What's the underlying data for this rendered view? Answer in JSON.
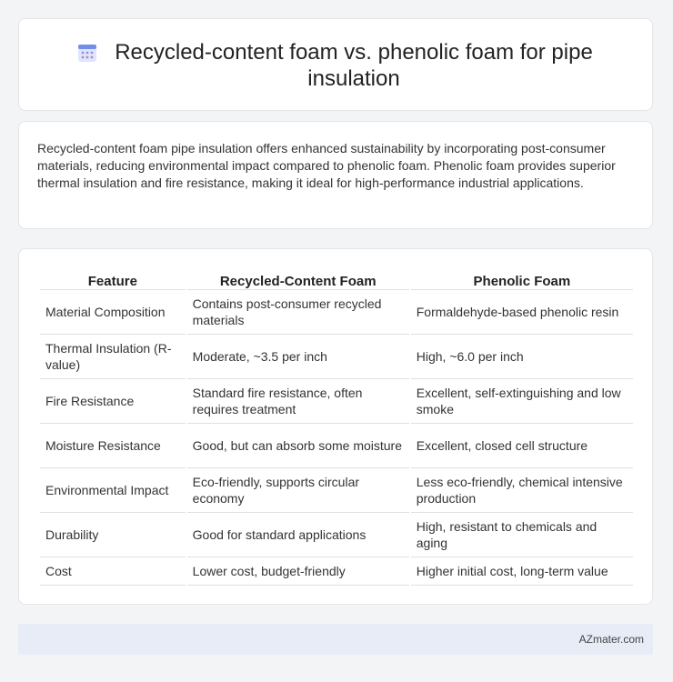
{
  "header": {
    "title": "Recycled-content foam vs. phenolic foam for pipe insulation",
    "icon": "calendar-icon"
  },
  "intro": {
    "text": "Recycled-content foam pipe insulation offers enhanced sustainability by incorporating post-consumer materials, reducing environmental impact compared to phenolic foam. Phenolic foam provides superior thermal insulation and fire resistance, making it ideal for high-performance industrial applications."
  },
  "table": {
    "headers": [
      "Feature",
      "Recycled-Content Foam",
      "Phenolic Foam"
    ],
    "rows": [
      [
        "Material Composition",
        "Contains post-consumer recycled materials",
        "Formaldehyde-based phenolic resin"
      ],
      [
        "Thermal Insulation (R-value)",
        "Moderate, ~3.5 per inch",
        "High, ~6.0 per inch"
      ],
      [
        "Fire Resistance",
        "Standard fire resistance, often requires treatment",
        "Excellent, self-extinguishing and low smoke"
      ],
      [
        "Moisture Resistance",
        "Good, but can absorb some moisture",
        "Excellent, closed cell structure"
      ],
      [
        "Environmental Impact",
        "Eco-friendly, supports circular economy",
        "Less eco-friendly, chemical intensive production"
      ],
      [
        "Durability",
        "Good for standard applications",
        "High, resistant to chemicals and aging"
      ],
      [
        "Cost",
        "Lower cost, budget-friendly",
        "Higher initial cost, long-term value"
      ]
    ]
  },
  "footer": {
    "text": "AZmater.com"
  }
}
